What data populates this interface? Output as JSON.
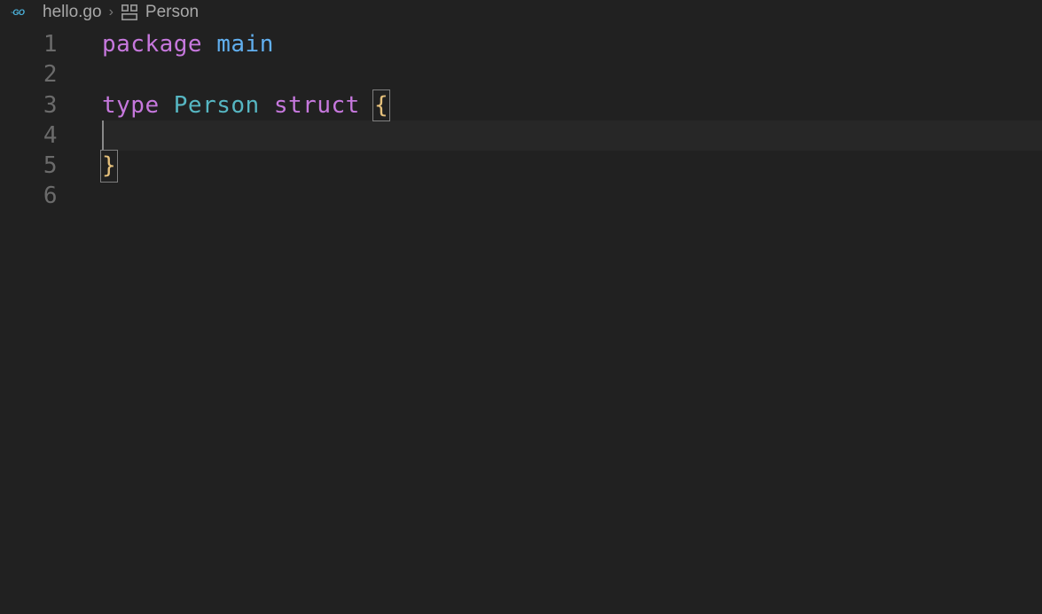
{
  "breadcrumb": {
    "filename": "hello.go",
    "separator": "›",
    "symbol": "Person"
  },
  "icons": {
    "go": "GO",
    "struct": "struct-icon"
  },
  "code": {
    "line_numbers": [
      "1",
      "2",
      "3",
      "4",
      "5",
      "6"
    ],
    "active_line_index": 3,
    "lines": [
      {
        "tokens": [
          {
            "text": "package",
            "class": "kw"
          },
          {
            "text": " ",
            "class": ""
          },
          {
            "text": "main",
            "class": "pkg-name"
          }
        ]
      },
      {
        "tokens": []
      },
      {
        "tokens": [
          {
            "text": "type",
            "class": "kw"
          },
          {
            "text": " ",
            "class": ""
          },
          {
            "text": "Person",
            "class": "type-name"
          },
          {
            "text": " ",
            "class": ""
          },
          {
            "text": "struct",
            "class": "kw"
          },
          {
            "text": " ",
            "class": ""
          },
          {
            "text": "{",
            "class": "brace matched"
          }
        ]
      },
      {
        "tokens": []
      },
      {
        "tokens": [
          {
            "text": "}",
            "class": "brace matched"
          }
        ]
      },
      {
        "tokens": []
      }
    ]
  }
}
